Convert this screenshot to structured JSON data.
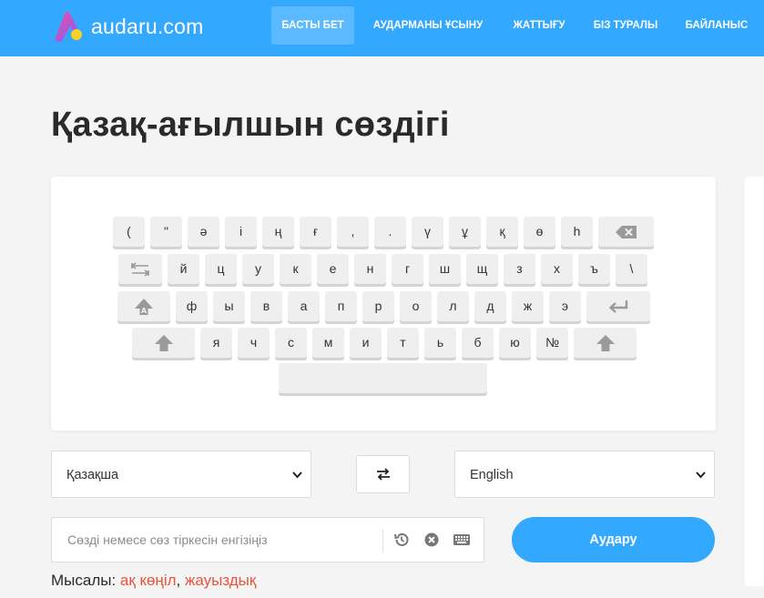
{
  "brand": {
    "name": "audaru.com",
    "accent": "#33a8ff",
    "logo_gradient": [
      "#f5d22b",
      "#f24fa0",
      "#7b5cff"
    ]
  },
  "nav": [
    {
      "label": "БАСТЫ БЕТ",
      "active": true
    },
    {
      "label": "АУДАРМАНЫ ҰСЫНУ",
      "active": false
    },
    {
      "label": "ЖАТТЫҒУ",
      "active": false
    },
    {
      "label": "БІЗ ТУРАЛЫ",
      "active": false
    },
    {
      "label": "БАЙЛАНЫС",
      "active": false
    }
  ],
  "page": {
    "title": "Қазақ-ағылшын сөздігі"
  },
  "keyboard": {
    "rows": [
      [
        "(",
        "\"",
        "ә",
        "і",
        "ң",
        "ғ",
        ",",
        ".",
        "ү",
        "ұ",
        "қ",
        "ө",
        "һ",
        "backspace-icon"
      ],
      [
        "tab-icon",
        "й",
        "ц",
        "у",
        "к",
        "е",
        "н",
        "г",
        "ш",
        "щ",
        "з",
        "х",
        "ъ",
        "\\"
      ],
      [
        "caps-lock-icon",
        "ф",
        "ы",
        "в",
        "а",
        "п",
        "р",
        "о",
        "л",
        "д",
        "ж",
        "э",
        "enter-icon"
      ],
      [
        "shift-icon",
        "я",
        "ч",
        "с",
        "м",
        "и",
        "т",
        "ь",
        "б",
        "ю",
        "№",
        "shift-icon"
      ],
      [
        "space"
      ]
    ]
  },
  "languages": {
    "source": "Қазақша",
    "target": "English",
    "swap_icon": "swap-arrows-icon"
  },
  "search": {
    "placeholder": "Сөзді немесе сөз тіркесін енгізіңіз",
    "value": "",
    "icons": [
      "history-icon",
      "clear-icon",
      "keyboard-icon"
    ]
  },
  "translate": {
    "label": "Аудару"
  },
  "examples": {
    "label": "Мысалы: ",
    "items": [
      "ақ көңіл",
      "жауыздық"
    ],
    "separator": ", ",
    "link_color": "#e8543c"
  }
}
